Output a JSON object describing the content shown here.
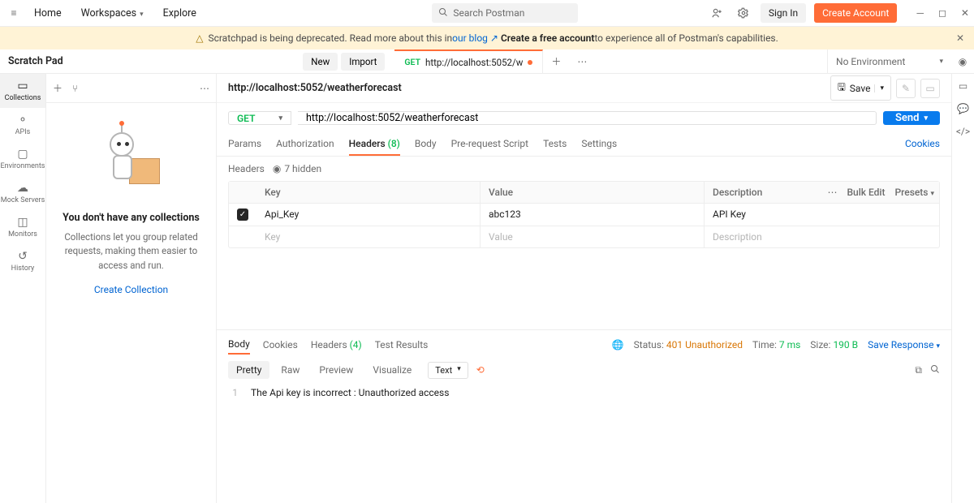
{
  "topbar": {
    "home": "Home",
    "workspaces": "Workspaces",
    "explore": "Explore",
    "search_placeholder": "Search Postman",
    "signin": "Sign In",
    "create": "Create Account"
  },
  "banner": {
    "pre": "Scratchpad is being deprecated. Read more about this in ",
    "blog": "our blog",
    "arrow": "↗",
    "mid": "Create a free account",
    "post": " to experience all of Postman's capabilities."
  },
  "subbar": {
    "title": "Scratch Pad",
    "new": "New",
    "import": "Import",
    "tab_method": "GET",
    "tab_label": "http://localhost:5052/w",
    "env": "No Environment"
  },
  "rail": {
    "collections": "Collections",
    "apis": "APIs",
    "environments": "Environments",
    "mock": "Mock Servers",
    "monitors": "Monitors",
    "history": "History"
  },
  "sidepanel": {
    "heading": "You don't have any collections",
    "desc": "Collections let you group related requests, making them easier to access and run.",
    "cta": "Create Collection"
  },
  "request": {
    "name": "http://localhost:5052/weatherforecast",
    "save": "Save",
    "method": "GET",
    "url": "http://localhost:5052/weatherforecast",
    "send": "Send",
    "tabs": {
      "params": "Params",
      "auth": "Authorization",
      "headers": "Headers",
      "headers_count": "(8)",
      "body": "Body",
      "prereq": "Pre-request Script",
      "tests": "Tests",
      "settings": "Settings",
      "cookies": "Cookies"
    },
    "headers_label": "Headers",
    "hidden": "7 hidden",
    "table": {
      "key_h": "Key",
      "val_h": "Value",
      "desc_h": "Description",
      "bulk": "Bulk Edit",
      "presets": "Presets",
      "rows": [
        {
          "key": "Api_Key",
          "value": "abc123",
          "desc": "API Key"
        }
      ],
      "ph_key": "Key",
      "ph_val": "Value",
      "ph_desc": "Description"
    }
  },
  "response": {
    "tabs": {
      "body": "Body",
      "cookies": "Cookies",
      "headers": "Headers",
      "headers_count": "(4)",
      "results": "Test Results"
    },
    "status_label": "Status:",
    "status_value": "401 Unauthorized",
    "time_label": "Time:",
    "time_value": "7 ms",
    "size_label": "Size:",
    "size_value": "190 B",
    "save": "Save Response",
    "view": {
      "pretty": "Pretty",
      "raw": "Raw",
      "preview": "Preview",
      "visualize": "Visualize",
      "format": "Text"
    },
    "line_no": "1",
    "body_text": "The Api key is incorrect : Unauthorized access"
  }
}
